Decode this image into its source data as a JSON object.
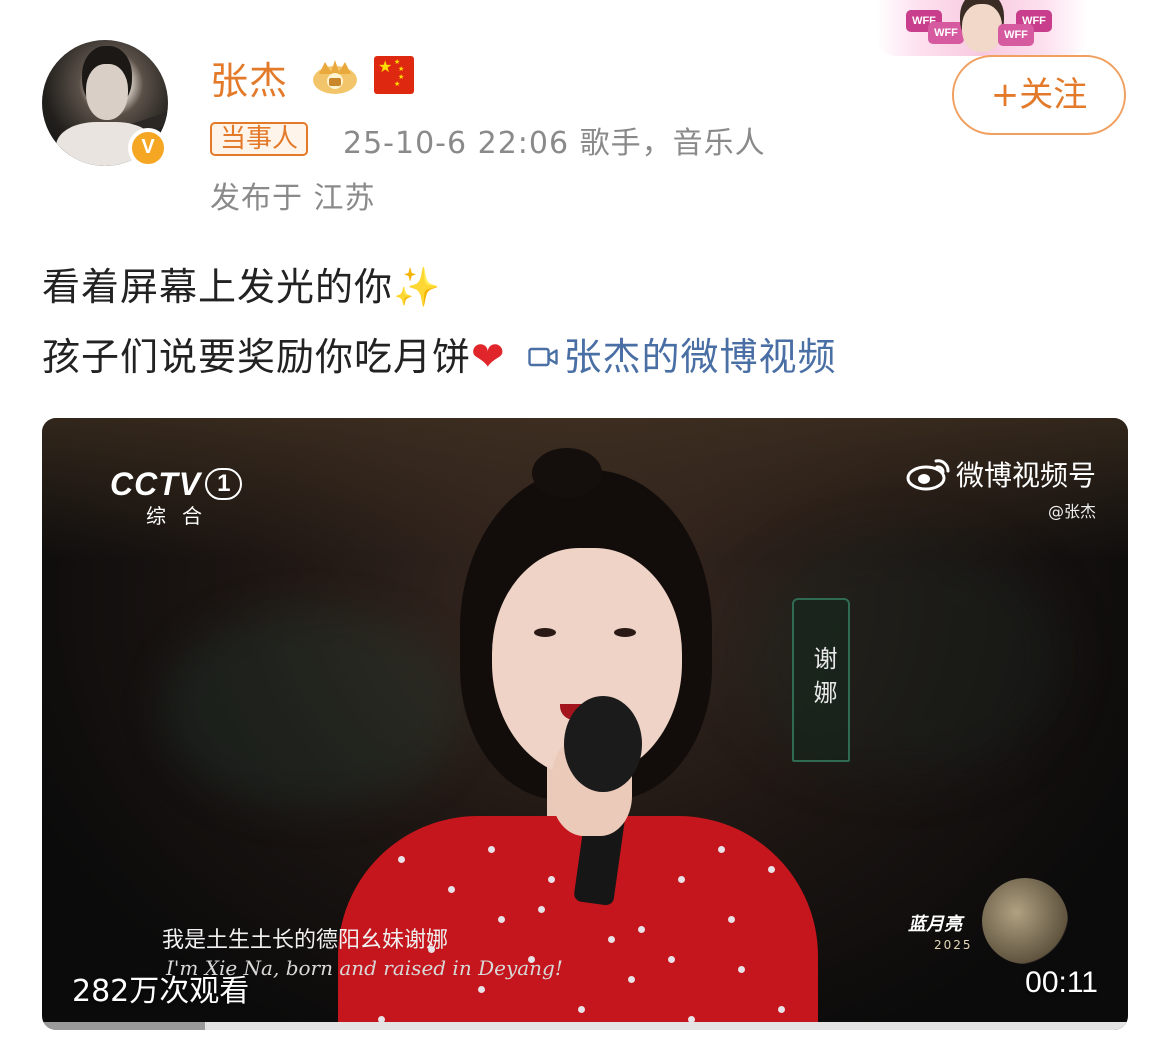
{
  "author": {
    "name": "张杰",
    "verified_mark": "V",
    "badge": "当事人",
    "meta": "25-10-6 22:06  歌手，音乐人",
    "location": "发布于 江苏"
  },
  "header": {
    "follow_label": "+关注",
    "sticker_tag": "WFF"
  },
  "post": {
    "line1": "看着屏幕上发光的你",
    "line2": "孩子们说要奖励你吃月饼",
    "video_link": "张杰的微博视频"
  },
  "video": {
    "channel_brand": "CCTV",
    "channel_number": "1",
    "channel_sub": "综合",
    "watermark_title": "微博视频号",
    "watermark_handle": "@张杰",
    "name_plaque": "谢娜",
    "subtitle_cn": "我是土生土长的德阳幺妹谢娜",
    "subtitle_en": "I'm Xie Na, born and raised in Deyang!",
    "event_brand": "蓝月亮",
    "event_year": "2025",
    "views": "282万次观看",
    "duration": "00:11",
    "progress_fraction": 0.15
  },
  "colors": {
    "accent": "#e37a2a",
    "link": "#4a6fa5",
    "heart": "#e0262a",
    "sparkle": "#f2c230"
  }
}
